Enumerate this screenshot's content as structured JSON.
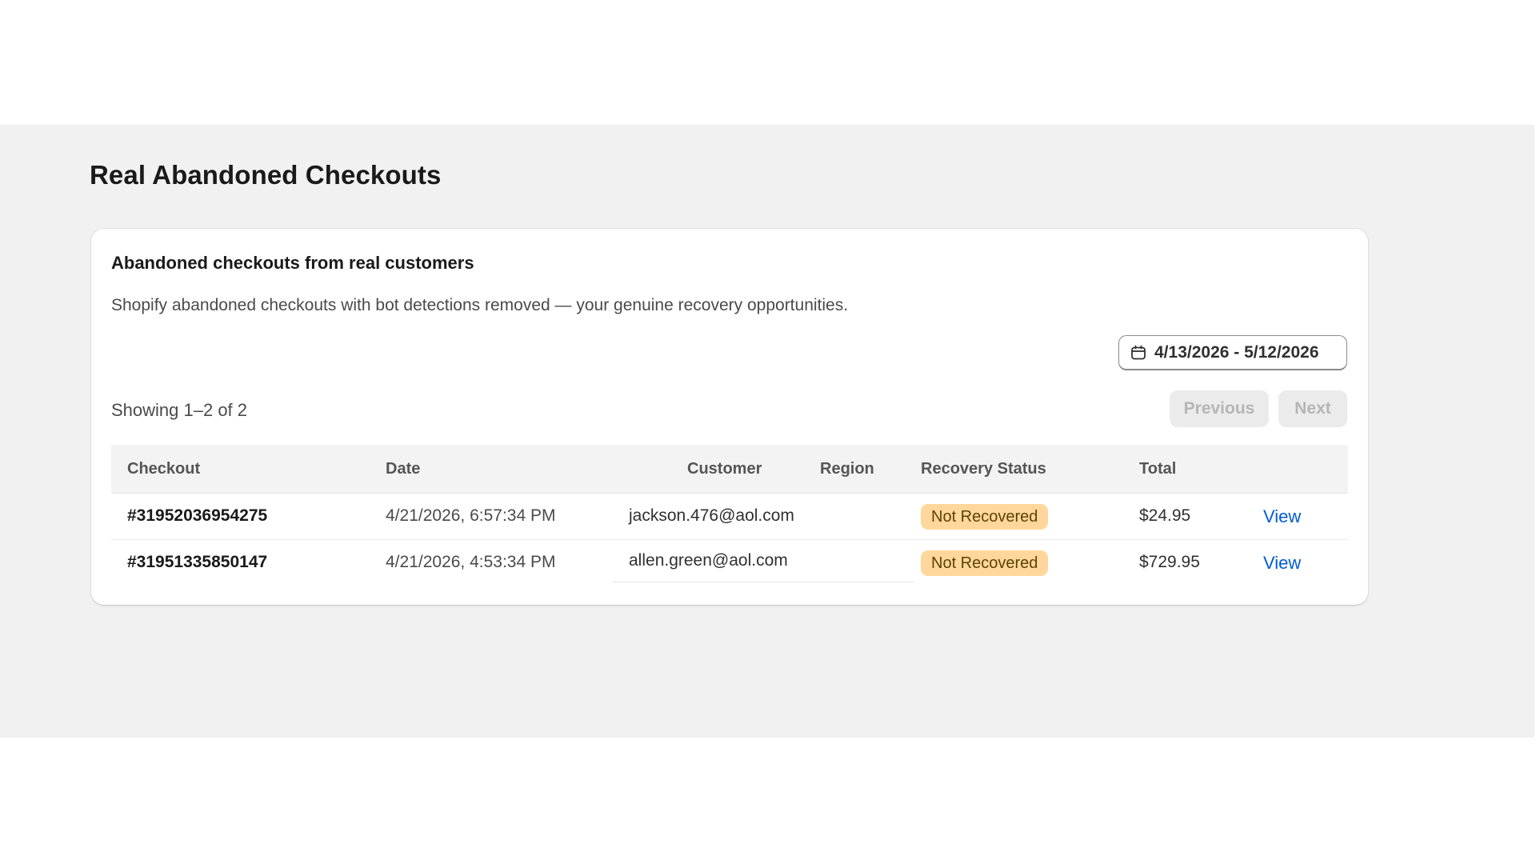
{
  "page": {
    "title": "Real Abandoned Checkouts"
  },
  "card": {
    "heading": "Abandoned checkouts from real customers",
    "description": "Shopify abandoned checkouts with bot detections removed — your genuine recovery opportunities.",
    "date_range": "4/13/2026 - 5/12/2026",
    "date_icon": "calendar-icon"
  },
  "pagination": {
    "summary": "Showing 1–2 of 2",
    "previous_label": "Previous",
    "next_label": "Next"
  },
  "table": {
    "headers": {
      "checkout": "Checkout",
      "date": "Date",
      "customer": "Customer",
      "region": "Region",
      "status": "Recovery Status",
      "total": "Total"
    },
    "rows": [
      {
        "checkout": "#31952036954275",
        "date": "4/21/2026, 6:57:34 PM",
        "customer": "jackson.476@aol.com",
        "region": "",
        "status": "Not Recovered",
        "total": "$24.95",
        "action": "View"
      },
      {
        "checkout": "#31951335850147",
        "date": "4/21/2026, 4:53:34 PM",
        "customer": "allen.green@aol.com",
        "region": "",
        "status": "Not Recovered",
        "total": "$729.95",
        "action": "View"
      }
    ]
  },
  "colors": {
    "background": "#f1f1f1",
    "badge_warning": "#ffd79d",
    "link": "#005bd3"
  }
}
